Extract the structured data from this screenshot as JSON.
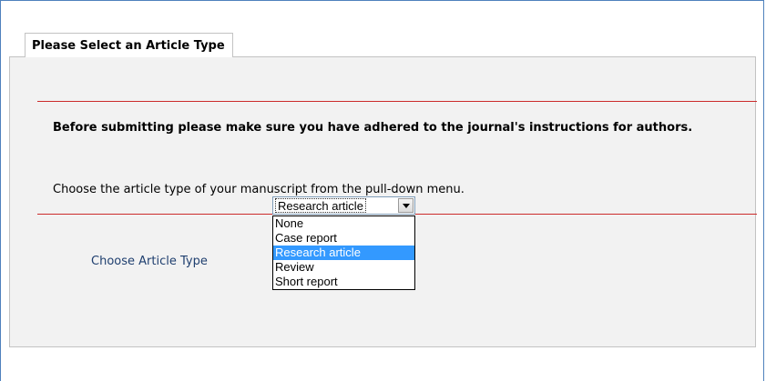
{
  "tab": {
    "title": "Please Select an Article Type"
  },
  "notice": {
    "text": "Before submitting please make sure you have adhered to the journal's instructions for authors."
  },
  "instruction": {
    "text": "Choose the article type of your manuscript from the pull-down menu."
  },
  "article_type": {
    "label": "Choose Article Type",
    "selected": "Research article",
    "options": [
      "None",
      "Case report",
      "Research article",
      "Review",
      "Short report"
    ],
    "highlighted_index": 2
  },
  "colors": {
    "frame_border": "#4f81bd",
    "panel_bg": "#f2f2f2",
    "rule": "#cc2b2b",
    "label": "#1f3f6f",
    "highlight": "#3399ff"
  },
  "icons": {
    "dropdown": "chevron-down-icon"
  }
}
